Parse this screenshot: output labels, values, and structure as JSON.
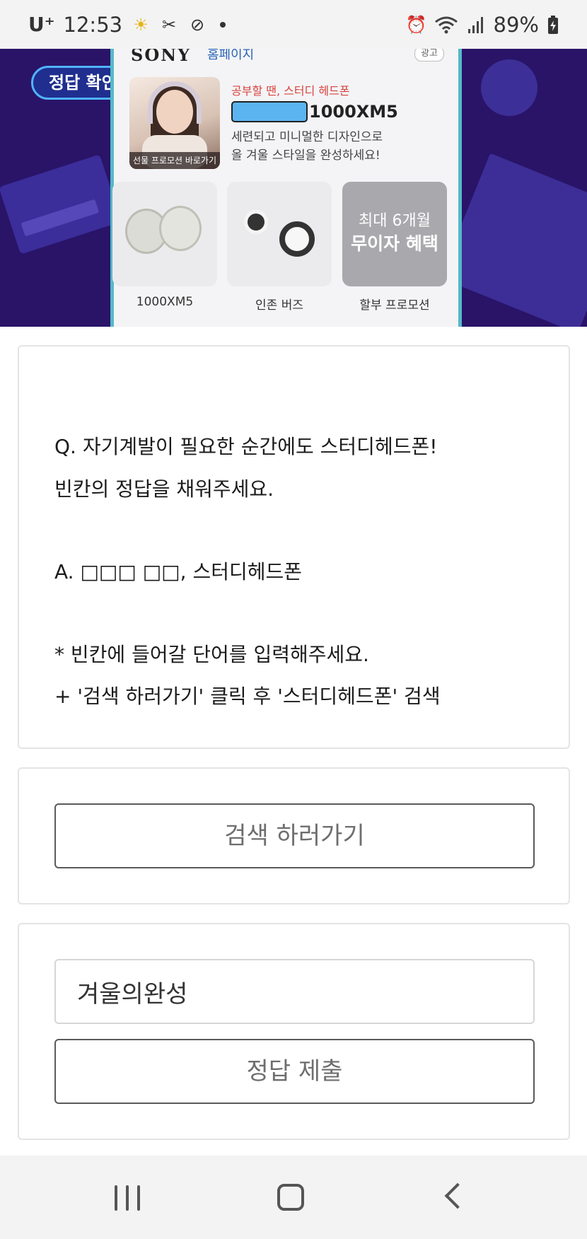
{
  "status_bar": {
    "carrier": "U⁺",
    "time": "12:53",
    "battery": "89%",
    "icons": [
      "weather-sun-icon",
      "tools-icon",
      "link-icon",
      "notification-dot-icon",
      "alarm-icon",
      "wifi-icon",
      "signal-icon",
      "battery-charging-icon"
    ]
  },
  "banner": {
    "badge_label": "정답 확인!",
    "ad": {
      "brand": "SONY",
      "home_link": "홈페이지",
      "ad_badge": "광고",
      "photo_caption": "선물 프로모션 바로가기",
      "headline": "공부할 땐, 스터디 헤드폰",
      "model_suffix": "1000XM5",
      "description_line1": "세련되고 미니멀한 디자인으로",
      "description_line2": "올 겨울 스타일을 완성하세요!",
      "promo_tile_line1": "최대 6개월",
      "promo_tile_line2": "무이자 혜택",
      "tiles": [
        {
          "label": "1000XM5"
        },
        {
          "label": "인존 버즈"
        },
        {
          "label": "할부 프로모션"
        }
      ]
    }
  },
  "question": {
    "q_line1": "Q. 자기계발이 필요한 순간에도 스터디헤드폰!",
    "q_line2": "빈칸의 정답을 채워주세요.",
    "answer_line": "A. □□□ □□, 스터디헤드폰",
    "hint_line1": "* 빈칸에 들어갈 단어를 입력해주세요.",
    "hint_line2": "+ '검색 하러가기' 클릭 후 '스터디헤드폰' 검색"
  },
  "search": {
    "button_label": "검색 하러가기"
  },
  "submit": {
    "input_value": "겨울의완성",
    "button_label": "정답 제출"
  },
  "colors": {
    "banner_bg": "#2a1468",
    "badge_border": "#4fb4ff",
    "ad_headline": "#d8433f",
    "redaction": "#5bb4f0"
  }
}
